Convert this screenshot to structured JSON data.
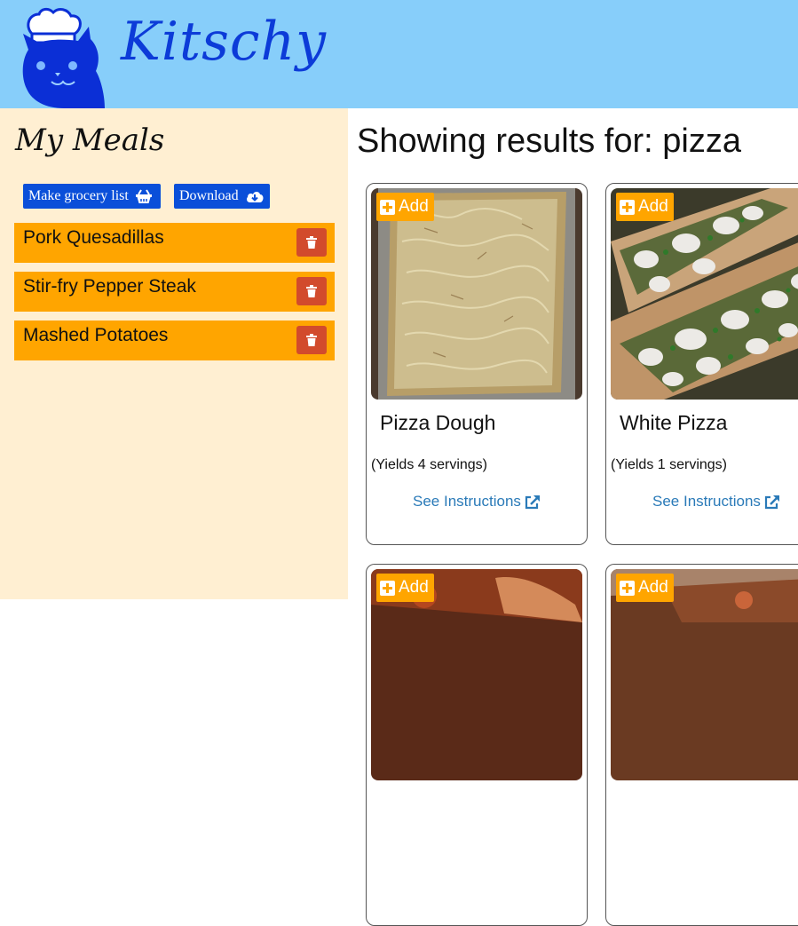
{
  "header": {
    "brand": "Kitschy"
  },
  "sidebar": {
    "title": "My Meals",
    "grocery_label": "Make grocery list",
    "download_label": "Download",
    "meals": [
      {
        "name": "Pork Quesadillas"
      },
      {
        "name": "Stir-fry Pepper Steak"
      },
      {
        "name": "Mashed Potatoes"
      }
    ]
  },
  "results": {
    "title": "Showing results for: pizza",
    "cards": [
      {
        "add_label": "Add",
        "title": "Pizza Dough",
        "yield": "(Yields 4 servings)",
        "link": "See Instructions"
      },
      {
        "add_label": "Add",
        "title": "White Pizza",
        "yield": "(Yields 1 servings)",
        "link": "See Instructions"
      },
      {
        "add_label": "Add"
      },
      {
        "add_label": "Add"
      }
    ]
  },
  "colors": {
    "header": "#87cefa",
    "sidebar": "#ffefd2",
    "accent_orange": "#ffa500",
    "button_blue": "#0a4fd9",
    "delete_red": "#d24b2c",
    "link_blue": "#2a7ab8"
  }
}
